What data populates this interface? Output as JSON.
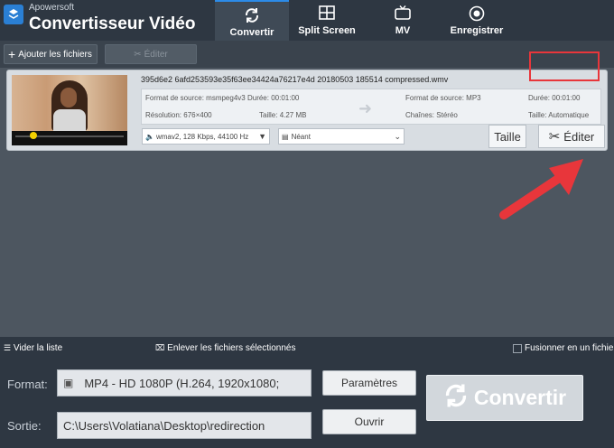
{
  "app": {
    "brand": "Apowersoft",
    "title": "Convertisseur Vidéo"
  },
  "tabs": [
    {
      "label": "Convertir",
      "icon": "refresh-icon",
      "active": true
    },
    {
      "label": "Split Screen",
      "icon": "split-screen-icon",
      "active": false
    },
    {
      "label": "MV",
      "icon": "tv-icon",
      "active": false
    },
    {
      "label": "Enregistrer",
      "icon": "record-icon",
      "active": false
    }
  ],
  "toolbar": {
    "add_files": "Ajouter les fichiers",
    "edit": "Éditer"
  },
  "file": {
    "name": "395d6e2 6afd253593e35f63ee34424a76217e4d 20180503 185514 compressed.wmv",
    "source": {
      "format_label": "Format de source:",
      "format": "msmpeg4v3",
      "duration_label": "Durée:",
      "duration": "00:01:00",
      "resolution_label": "Résolution:",
      "resolution": "676×400",
      "size_label": "Taille:",
      "size": "4.27 MB"
    },
    "target": {
      "format_label": "Format de source:",
      "format": "MP3",
      "duration_label": "Durée:",
      "duration": "00:01:00",
      "channels_label": "Chaînes:",
      "channels": "Stéréo",
      "size_label": "Taille:",
      "size": "Automatique"
    },
    "audio_track": "wmav2, 128 Kbps, 44100 Hz",
    "subtitle": "Néant",
    "size_button": "Taille",
    "edit_button": "Éditer"
  },
  "bottom": {
    "clear_list": "Vider la liste",
    "remove_selected": "Enlever les fichiers sélectionnés",
    "merge": "Fusionner en un fichier",
    "format_label": "Format:",
    "format_value": "MP4 - HD 1080P (H.264, 1920x1080;",
    "output_label": "Sortie:",
    "output_value": "C:\\Users\\Volatiana\\Desktop\\redirection",
    "params_button": "Paramètres",
    "open_button": "Ouvrir",
    "convert_button": "Convertir"
  },
  "colors": {
    "accent": "#2c8be8",
    "highlight": "#e8363b"
  }
}
